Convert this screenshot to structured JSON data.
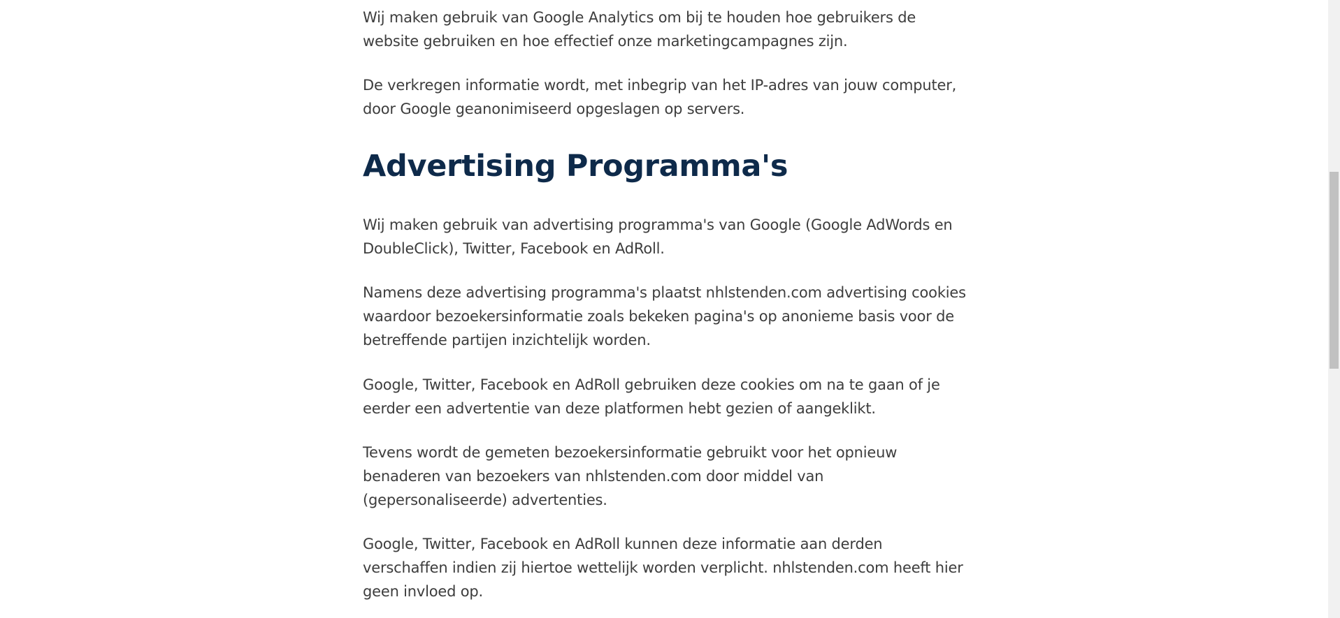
{
  "article": {
    "paragraphs": [
      "Wij maken gebruik van Google Analytics om bij te houden hoe gebruikers de website gebruiken en hoe effectief onze marketingcampagnes zijn.",
      "De verkregen informatie wordt, met inbegrip van het IP-adres van jouw computer, door Google geanonimiseerd opgeslagen op servers."
    ],
    "heading": "Advertising Programma's",
    "section_paragraphs": [
      "Wij maken gebruik van advertising programma's van Google (Google AdWords en DoubleClick), Twitter, Facebook en AdRoll.",
      "Namens deze advertising programma's plaatst nhlstenden.com advertising cookies waardoor bezoekersinformatie zoals bekeken pagina's op anonieme basis voor de betreffende partijen inzichtelijk worden.",
      "Google, Twitter, Facebook en AdRoll gebruiken deze cookies om na te gaan of je eerder een advertentie van deze platformen hebt gezien of aangeklikt.",
      "Tevens wordt de gemeten bezoekersinformatie gebruikt voor het opnieuw benaderen van bezoekers van nhlstenden.com door middel van (gepersonaliseerde) advertenties.",
      "Google, Twitter, Facebook en AdRoll kunnen deze informatie aan derden verschaffen indien zij hiertoe wettelijk worden verplicht. nhlstenden.com heeft hier geen invloed op."
    ]
  },
  "colors": {
    "heading": "#0e2a4a",
    "body_text": "#3d3d3d",
    "background": "#ffffff"
  }
}
